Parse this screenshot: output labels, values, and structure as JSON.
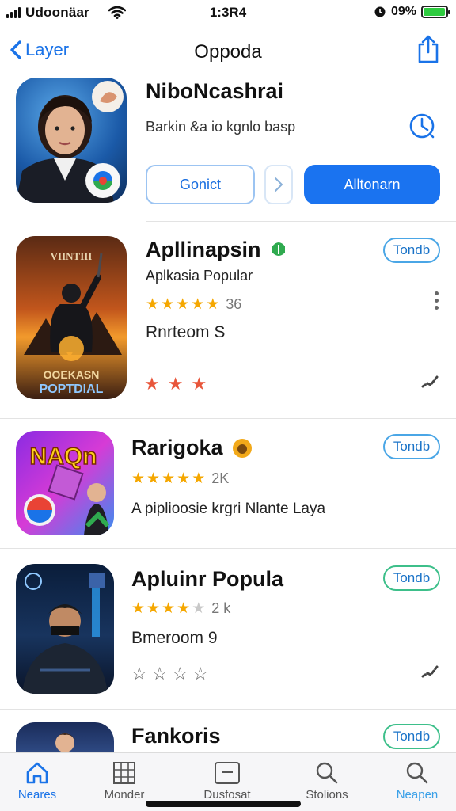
{
  "status_bar": {
    "carrier": "Udoonäar",
    "time": "1:3R4",
    "battery_text": "09%",
    "battery_level": 0.95
  },
  "nav": {
    "back_label": "Layer",
    "title": "Oppoda",
    "share_icon": "share-icon"
  },
  "featured": {
    "name": "NiboNcashrai",
    "subtitle": "Barkin &a io kgnlo basp",
    "compass_icon": "compass-icon",
    "outline_button": "Gonict",
    "primary_button": "Alltonarn"
  },
  "apps": [
    {
      "name": "Apllinapsin",
      "subtitle": "Aplkasia Popular",
      "rating": 4.5,
      "rating_count": "36",
      "extra": "Rnrteom S",
      "action": "Tondb",
      "art_title_top": "VIINTIII",
      "art_title_bottom1": "OOEKASN",
      "art_title_bottom2": "POPTDIAL",
      "mini_stars": [
        "★",
        "★",
        "★"
      ]
    },
    {
      "name": "Rarigoka",
      "rating": 4.5,
      "rating_count": "2K",
      "subtitle": "A piplioosie krgri Nlante Laya",
      "action": "Tondb",
      "art_title": "NAQn"
    },
    {
      "name": "Apluinr Popula",
      "rating": 3.5,
      "rating_count": "2 k",
      "extra": "Bmeroom 9",
      "action": "Tondb",
      "outline_stars": [
        "☆",
        "☆",
        "☆",
        "☆"
      ]
    },
    {
      "name": "Fankoris",
      "action": "Tondb"
    }
  ],
  "tabs": [
    {
      "label": "Neares",
      "icon": "home-icon",
      "active": true
    },
    {
      "label": "Monder",
      "icon": "grid-icon",
      "active": false
    },
    {
      "label": "Dusfosat",
      "icon": "tray-icon",
      "active": false
    },
    {
      "label": "Stolions",
      "icon": "search-icon",
      "active": false
    },
    {
      "label": "Neapen",
      "icon": "search-icon",
      "active": false
    }
  ],
  "colors": {
    "accent": "#1a73e8",
    "primary_button": "#1a73f0",
    "star": "#f5a700",
    "battery": "#2ecc40"
  }
}
